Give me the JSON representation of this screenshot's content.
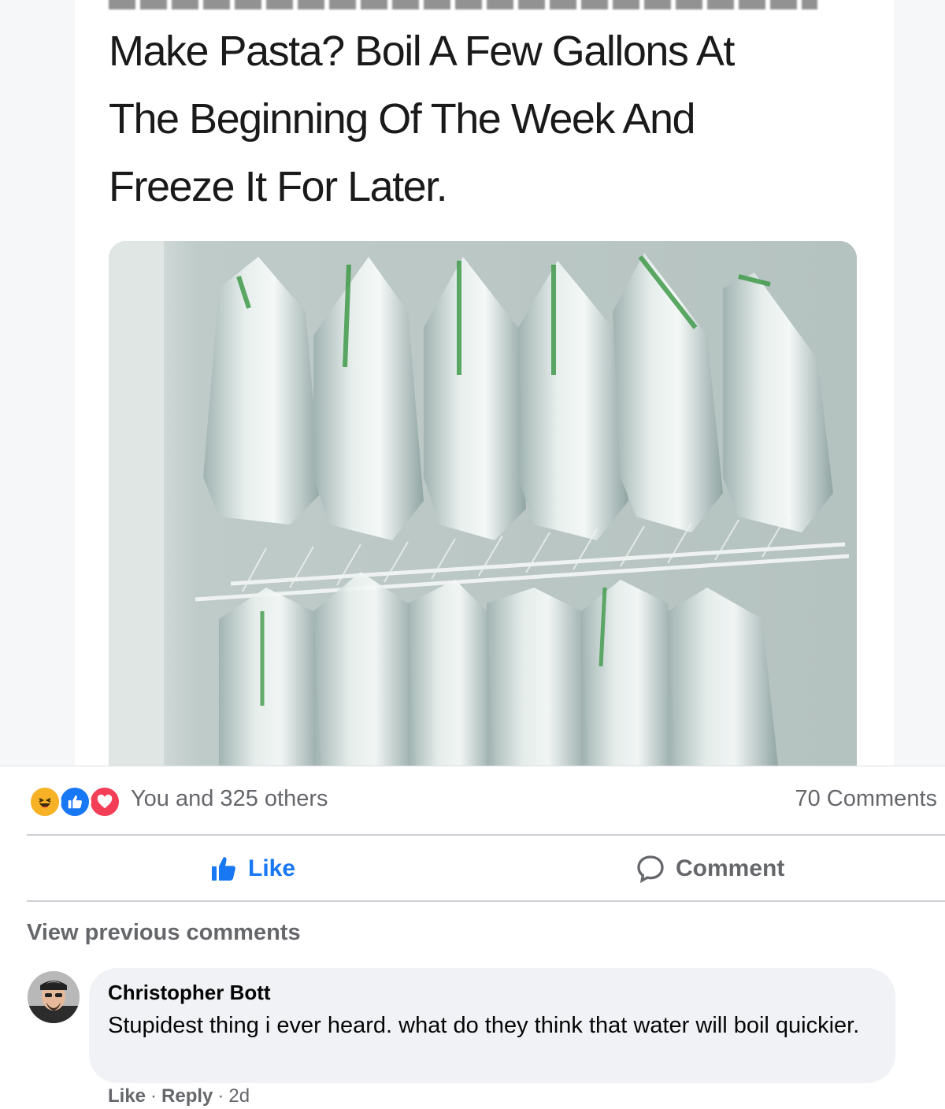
{
  "meme": {
    "title_lines": [
      "Make Pasta? Boil A Few Gallons At",
      "The Beginning Of The Week And",
      "Freeze It For Later."
    ]
  },
  "post": {
    "reactions": {
      "icons": [
        "haha-icon",
        "like-icon",
        "love-icon"
      ],
      "summary": "You and 325 others"
    },
    "comments_count": "70 Comments",
    "actions": {
      "like_label": "Like",
      "comment_label": "Comment"
    },
    "view_previous": "View previous comments"
  },
  "comment": {
    "author": "Christopher Bott",
    "text": "Stupidest thing i ever heard. what do they think that water will boil quickier.",
    "like_label": "Like",
    "reply_label": "Reply",
    "time": "2d"
  },
  "colors": {
    "accent": "#1877f2",
    "secondary_text": "#65676b",
    "bubble": "#f0f2f5"
  }
}
